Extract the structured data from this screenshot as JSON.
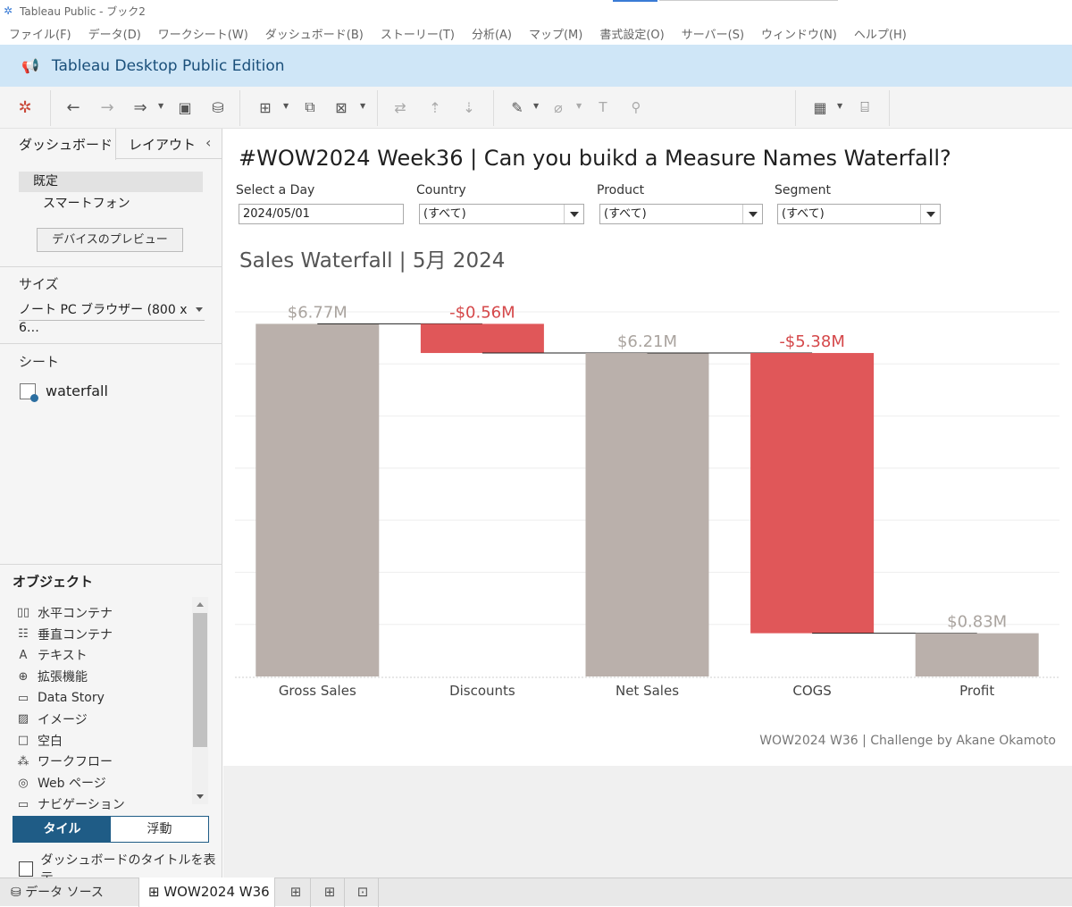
{
  "window": {
    "title": "Tableau Public - ブック2"
  },
  "menu": [
    "ファイル(F)",
    "データ(D)",
    "ワークシート(W)",
    "ダッシュボード(B)",
    "ストーリー(T)",
    "分析(A)",
    "マップ(M)",
    "書式設定(O)",
    "サーバー(S)",
    "ウィンドウ(N)",
    "ヘルプ(H)"
  ],
  "banner": {
    "text": "Tableau Desktop Public Edition"
  },
  "left_panel": {
    "tab_dashboard": "ダッシュボード",
    "tab_layout": "レイアウト",
    "devices": {
      "default": "既定",
      "phone": "スマートフォン"
    },
    "preview_button": "デバイスのプレビュー",
    "size_label": "サイズ",
    "size_value": "ノート PC ブラウザー (800 x 6…",
    "sheets_label": "シート",
    "sheets": [
      "waterfall"
    ],
    "objects_label": "オブジェクト",
    "objects": [
      {
        "icon": "horizontal-container-icon",
        "label": "水平コンテナ"
      },
      {
        "icon": "vertical-container-icon",
        "label": "垂直コンテナ"
      },
      {
        "icon": "text-icon",
        "label": "テキスト"
      },
      {
        "icon": "extension-icon",
        "label": "拡張機能"
      },
      {
        "icon": "data-story-icon",
        "label": "Data Story"
      },
      {
        "icon": "image-icon",
        "label": "イメージ"
      },
      {
        "icon": "blank-icon",
        "label": "空白"
      },
      {
        "icon": "workflow-icon",
        "label": "ワークフロー"
      },
      {
        "icon": "web-page-icon",
        "label": "Web ページ"
      },
      {
        "icon": "navigation-icon",
        "label": "ナビゲーション"
      }
    ],
    "tiled_label": "タイル",
    "floating_label": "浮動",
    "show_title_label": "ダッシュボードのタイトルを表示"
  },
  "dashboard": {
    "title": "#WOW2024 Week36 | Can you buikd a Measure Names Waterfall?",
    "filters": [
      {
        "label": "Select a Day",
        "value": "2024/05/01",
        "dropdown": false
      },
      {
        "label": "Country",
        "value": "(すべて)",
        "dropdown": true
      },
      {
        "label": "Product",
        "value": "(すべて)",
        "dropdown": true
      },
      {
        "label": "Segment",
        "value": "(すべて)",
        "dropdown": true
      }
    ],
    "chart_title": "Sales Waterfall | 5月 2024",
    "credit": "WOW2024 W36 | Challenge by Akane Okamoto"
  },
  "chart_data": {
    "type": "bar",
    "subtype": "waterfall",
    "title": "Sales Waterfall | 5月 2024",
    "categories": [
      "Gross Sales",
      "Discounts",
      "Net Sales",
      "COGS",
      "Profit"
    ],
    "values": [
      6.77,
      -0.56,
      6.21,
      -5.38,
      0.83
    ],
    "is_total": [
      true,
      false,
      true,
      false,
      true
    ],
    "labels": [
      "$6.77M",
      "-$0.56M",
      "$6.21M",
      "-$5.38M",
      "$0.83M"
    ],
    "unit": "$M",
    "ylim": [
      0,
      7.0
    ],
    "grid": true,
    "colors": {
      "total": "#bab0ab",
      "negative": "#e05759",
      "total_label": "#aaa49f",
      "negative_label": "#d5484a"
    }
  },
  "bottom_bar": {
    "data_source": "データ ソース",
    "sheet_tab": "WOW2024 W36"
  }
}
